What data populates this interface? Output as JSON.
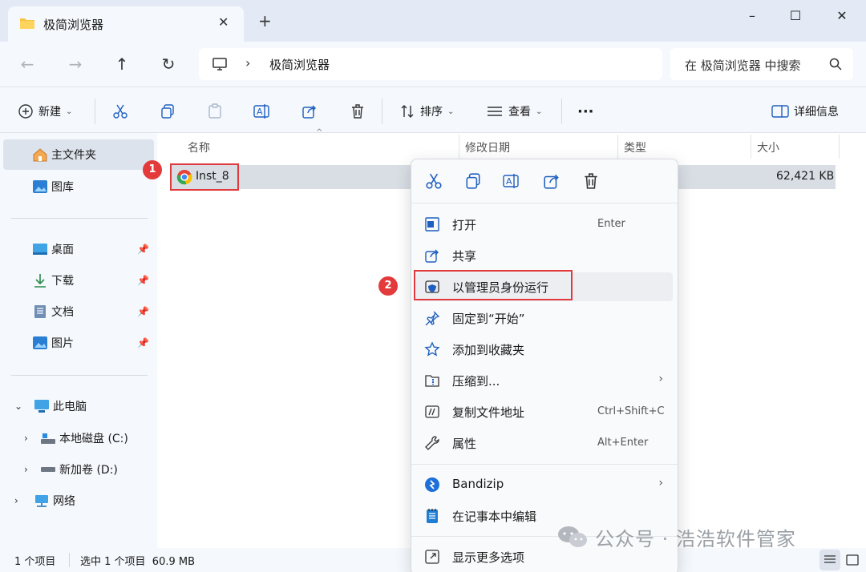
{
  "window": {
    "tab_title": "极简浏览器",
    "new_tab": "+",
    "minimize": "–",
    "maximize": "☐",
    "close": "✕"
  },
  "address": {
    "path": "极简浏览器",
    "search_placeholder": "在 极简浏览器 中搜索"
  },
  "toolbar": {
    "new_label": "新建",
    "sort_label": "排序",
    "view_label": "查看",
    "more_label": "···",
    "details_label": "详细信息"
  },
  "sidebar": {
    "home": "主文件夹",
    "gallery": "图库",
    "desktop": "桌面",
    "downloads": "下载",
    "documents": "文档",
    "pictures": "图片",
    "this_pc": "此电脑",
    "local_disk": "本地磁盘 (C:)",
    "new_volume": "新加卷 (D:)",
    "network": "网络"
  },
  "columns": {
    "name": "名称",
    "modified": "修改日期",
    "type": "类型",
    "size": "大小"
  },
  "file": {
    "name": "Inst_8",
    "size": "62,421 KB"
  },
  "badges": {
    "first": "1",
    "second": "2"
  },
  "context_menu": {
    "items": [
      {
        "label": "打开",
        "shortcut": "Enter"
      },
      {
        "label": "共享",
        "shortcut": ""
      },
      {
        "label": "以管理员身份运行",
        "shortcut": ""
      },
      {
        "label": "固定到“开始”",
        "shortcut": ""
      },
      {
        "label": "添加到收藏夹",
        "shortcut": ""
      },
      {
        "label": "压缩到...",
        "shortcut": ""
      },
      {
        "label": "复制文件地址",
        "shortcut": "Ctrl+Shift+C"
      },
      {
        "label": "属性",
        "shortcut": "Alt+Enter"
      },
      {
        "label": "Bandizip",
        "shortcut": ""
      },
      {
        "label": "在记事本中编辑",
        "shortcut": ""
      },
      {
        "label": "显示更多选项",
        "shortcut": ""
      }
    ]
  },
  "status": {
    "count": "1 个项目",
    "selected": "选中 1 个项目  60.9 MB"
  },
  "watermark": "公众号 · 浩浩软件管家",
  "colors": {
    "highlight_red": "#e0393e",
    "badge_red": "#e33b3b",
    "selection_gray": "#d9dee5"
  }
}
